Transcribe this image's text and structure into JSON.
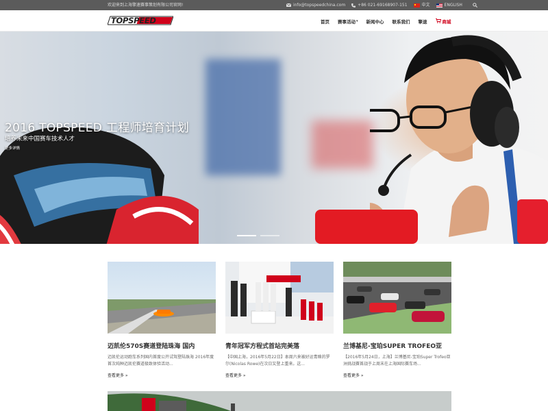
{
  "topbar": {
    "welcome": "欢迎来到上海擎速赛事策划有限公司官网!",
    "email": "info@topspeedchina.com",
    "phone": "+86 021-69168907-151",
    "lang_cn": "中文",
    "lang_en": "ENGLISH"
  },
  "header": {
    "logo_text": "TOPSPEED",
    "nav": [
      {
        "label": "首页"
      },
      {
        "label": "赛事活动"
      },
      {
        "label": "新闻中心"
      },
      {
        "label": "联系我们"
      },
      {
        "label": "擎速"
      },
      {
        "label": "商城"
      }
    ]
  },
  "hero": {
    "title": "2016 TOPSPEED 工程师培育计划",
    "subtitle": "培养未来中国赛车技术人才",
    "more": "更多详情",
    "slides_count": 2,
    "active_slide": 1
  },
  "news": [
    {
      "title": "迈凯伦570S赛道登陆珠海 国内",
      "excerpt": "迈凯伦运动跑车系列国内首度公开试驾登陆珠海 2016年度首次纯种迈凯伦赛道极致体验活动...",
      "more": "查看更多 »"
    },
    {
      "title": "青年冠军方程式首站完美落",
      "excerpt": "【中国上海，2016年5月22日】本周六来被好运青睐的罗尔(Nicolas Rowe)在次日又登上重来。这...",
      "more": "查看更多 »"
    },
    {
      "title": "兰博基尼-宝珀SUPER TROFEO亚",
      "excerpt": "【2016年5月24日，上海】兰博基尼-宝珀Super Trofeo亚洲挑战赛首战于上周末在上海国际赛车场...",
      "more": "查看更多 »"
    }
  ],
  "colors": {
    "topbar_bg": "#5b5b5b",
    "brand_red": "#d0021b",
    "text_dark": "#333333"
  }
}
